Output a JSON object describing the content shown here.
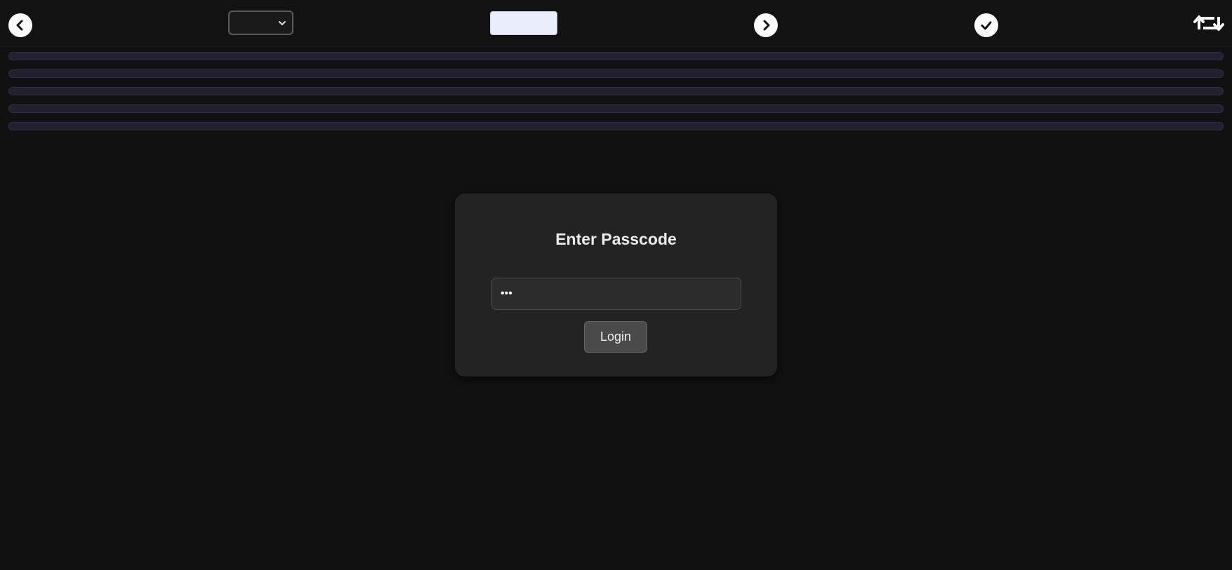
{
  "toolbar": {
    "prev_icon": "chevron-left-circle-icon",
    "select_value": "",
    "blank_button_label": "",
    "next_icon": "chevron-right-circle-icon",
    "check_icon": "check-circle-icon",
    "swap_icon": "repeat-swap-icon"
  },
  "progress_bars": [
    {
      "fill_fraction": 0
    },
    {
      "fill_fraction": 0
    },
    {
      "fill_fraction": 0
    },
    {
      "fill_fraction": 0
    },
    {
      "fill_fraction": 0
    }
  ],
  "login_card": {
    "title": "Enter Passcode",
    "passcode_value": "abc",
    "login_label": "Login"
  },
  "colors": {
    "background": "#111111",
    "card": "#232323",
    "bar_track": "#20202e",
    "accent_light": "#e8eefc"
  }
}
